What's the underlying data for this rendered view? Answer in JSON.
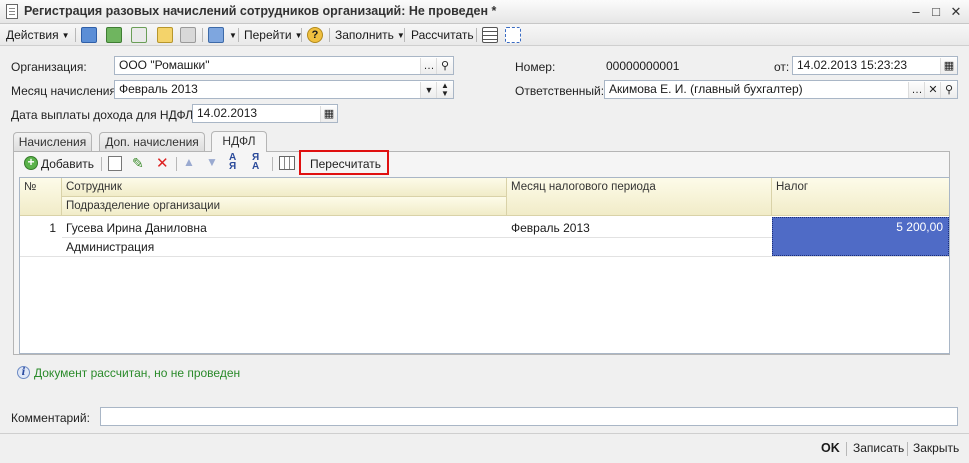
{
  "window": {
    "title": "Регистрация разовых начислений сотрудников организаций: Не проведен *",
    "minimize": "–",
    "maximize": "□",
    "close": "✕"
  },
  "toolbar": {
    "actions_label": "Действия",
    "goto_label": "Перейти",
    "fill_label": "Заполнить",
    "recalc_label": "Рассчитать",
    "help_glyph": "?"
  },
  "form": {
    "organization_label": "Организация:",
    "organization_value": "ООО \"Ромашки\"",
    "month_label": "Месяц начисления:",
    "month_value": "Февраль 2013",
    "payout_date_label": "Дата выплаты дохода для НДФЛ:",
    "payout_date_value": "14.02.2013",
    "number_label": "Номер:",
    "number_value": "00000000001",
    "from_label": "от:",
    "from_value": "14.02.2013 15:23:23",
    "responsible_label": "Ответственный:",
    "responsible_value": "Акимова Е. И. (главный бухгалтер)"
  },
  "tabs": [
    {
      "label": "Начисления"
    },
    {
      "label": "Доп. начисления"
    },
    {
      "label": "НДФЛ"
    }
  ],
  "panel_toolbar": {
    "add_label": "Добавить",
    "recount_label": "Пересчитать"
  },
  "table": {
    "headers": {
      "num": "№",
      "employee": "Сотрудник",
      "department": "Подразделение организации",
      "tax_period": "Месяц налогового периода",
      "tax": "Налог"
    },
    "rows": [
      {
        "num": "1",
        "employee": "Гусева Ирина Даниловна",
        "department": "Администрация",
        "tax_period": "Февраль 2013",
        "tax": "5 200,00"
      }
    ]
  },
  "info": {
    "message": "Документ рассчитан, но не проведен",
    "icon_glyph": "i"
  },
  "comment": {
    "label": "Комментарий:",
    "value": ""
  },
  "footer": {
    "ok_label": "OK",
    "save_label": "Записать",
    "close_label": "Закрыть"
  },
  "colors": {
    "selected_cell": "#4f6bc6",
    "highlight_border": "#e01010",
    "info_text": "#2a8a2a"
  }
}
